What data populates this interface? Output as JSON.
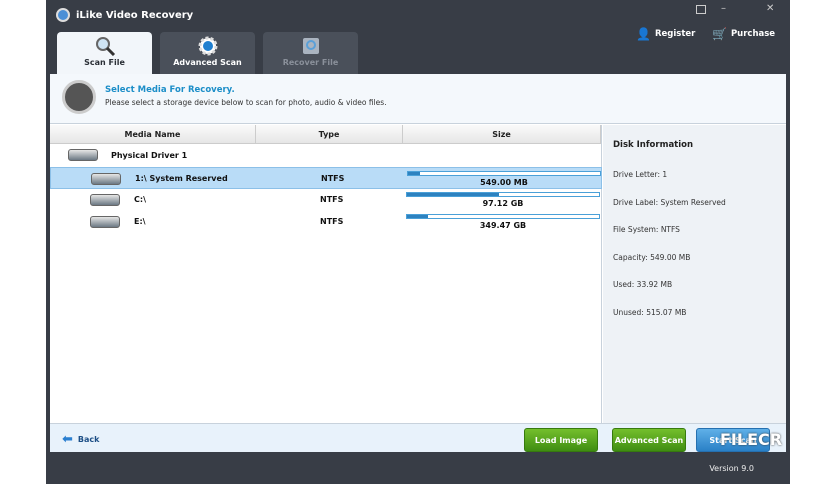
{
  "app": {
    "title": "iLike Video Recovery",
    "version": "Version 9.0"
  },
  "top_actions": {
    "register": "Register",
    "purchase": "Purchase"
  },
  "tabs": [
    {
      "label": "Scan File",
      "state": "active"
    },
    {
      "label": "Advanced Scan",
      "state": "normal"
    },
    {
      "label": "Recover File",
      "state": "disabled"
    }
  ],
  "header": {
    "title": "Select Media For Recovery.",
    "subtitle": "Please select a storage device below to scan for photo, audio & video files."
  },
  "table": {
    "columns": [
      "Media Name",
      "Type",
      "Size"
    ],
    "group": "Physical Driver 1",
    "rows": [
      {
        "name": "1:\\ System Reserved",
        "type": "NTFS",
        "size": "549.00 MB",
        "used_fraction": 0.06,
        "selected": true
      },
      {
        "name": "C:\\",
        "type": "NTFS",
        "size": "97.12 GB",
        "used_fraction": 0.48,
        "selected": false
      },
      {
        "name": "E:\\",
        "type": "NTFS",
        "size": "349.47 GB",
        "used_fraction": 0.11,
        "selected": false
      }
    ]
  },
  "disk_info": {
    "title": "Disk Information",
    "lines": [
      "Drive Letter: 1",
      "Drive Label: System Reserved",
      "File System: NTFS",
      "Capacity: 549.00 MB",
      "Used: 33.92 MB",
      "Unused: 515.07 MB"
    ]
  },
  "footer": {
    "back": "Back",
    "load_image": "Load Image",
    "advanced_scan": "Advanced Scan",
    "start_scan": "Start Scan"
  },
  "watermark": "FILECR"
}
